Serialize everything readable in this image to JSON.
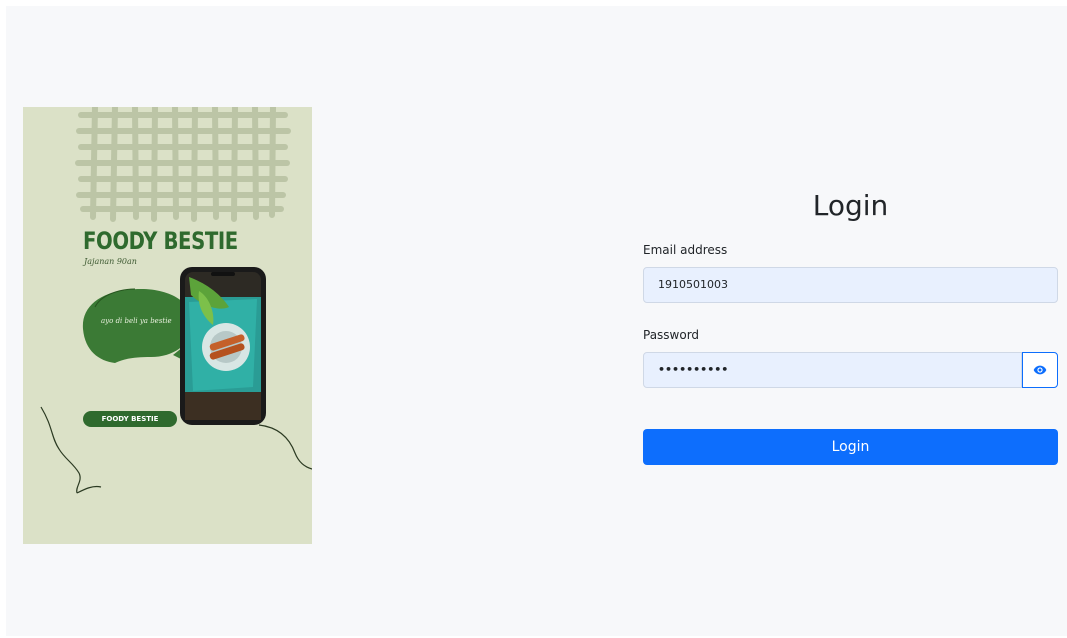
{
  "poster": {
    "brand": "FOODY BESTIE",
    "tagline": "Jajanan 90an",
    "bubble_text": "ayo di beli ya bestie",
    "pill_label": "FOODY BESTIE",
    "colors": {
      "background": "#dbe1c7",
      "brand_green": "#2f6a2e",
      "bubble_green": "#3b7a35"
    }
  },
  "login": {
    "heading": "Login",
    "email_label": "Email address",
    "email_value": "1910501003",
    "password_label": "Password",
    "password_value": "••••••••••",
    "toggle_icon": "eye-icon",
    "submit_label": "Login",
    "colors": {
      "primary": "#0d6efd",
      "input_fill": "#e8f0fe"
    }
  }
}
